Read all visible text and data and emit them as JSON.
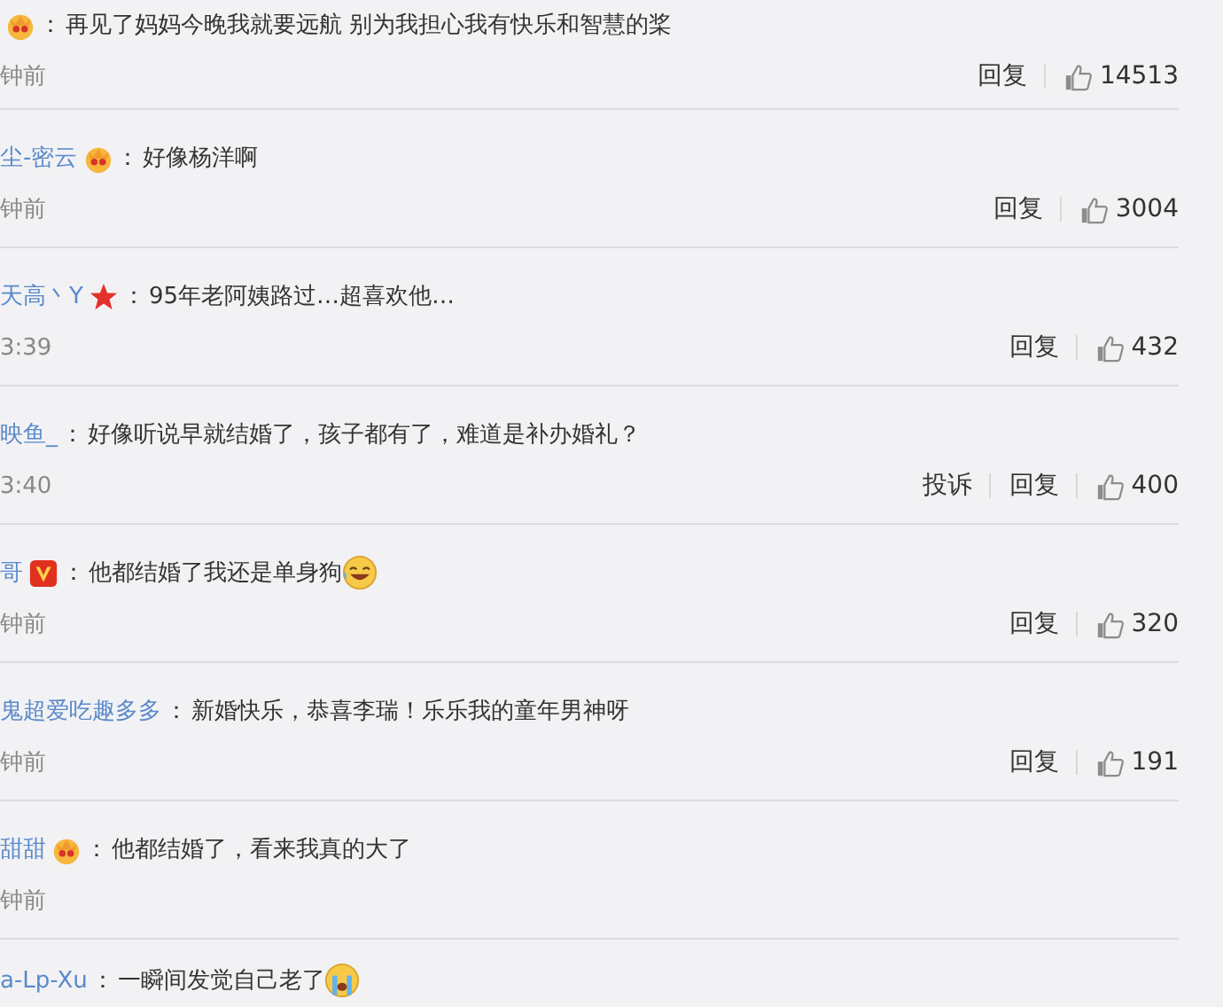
{
  "comments": [
    {
      "badge": {
        "kind": "crown"
      },
      "separator": "：",
      "text": "再见了妈妈今晚我就要远航 别为我担心我有快乐和智慧的桨",
      "time": "钟前",
      "reply": "回复",
      "likes": "14513"
    },
    {
      "name": "尘-密云",
      "badge": {
        "kind": "crown"
      },
      "separator": "：",
      "text": "好像杨洋啊",
      "time": "钟前",
      "reply": "回复",
      "likes": "3004"
    },
    {
      "name": "天高丶Y",
      "badge": {
        "kind": "star"
      },
      "separator": "：",
      "text": "95年老阿姨路过…超喜欢他…",
      "time": "3:39",
      "reply": "回复",
      "likes": "432"
    },
    {
      "name": "映鱼_",
      "separator": "：",
      "text": "好像听说早就结婚了，孩子都有了，难道是补办婚礼？",
      "time": "3:40",
      "report": "投诉",
      "reply": "回复",
      "likes": "400"
    },
    {
      "name": "哥",
      "badge": {
        "kind": "vip"
      },
      "separator": "：",
      "text": "他都结婚了我还是单身狗",
      "emoji": {
        "kind": "laugh"
      },
      "time": "钟前",
      "reply": "回复",
      "likes": "320"
    },
    {
      "name": "鬼超爱吃趣多多",
      "separator": "：",
      "text": "新婚快乐，恭喜李瑞！乐乐我的童年男神呀",
      "time": "钟前",
      "reply": "回复",
      "likes": "191"
    },
    {
      "name": "甜甜",
      "badge": {
        "kind": "crown"
      },
      "separator": "：",
      "text": "他都结婚了，看来我真的大了",
      "time": "钟前"
    },
    {
      "name": "a-Lp-Xu",
      "separator": "：",
      "text": "一瞬间发觉自己老了",
      "emoji": {
        "kind": "cry"
      }
    }
  ]
}
